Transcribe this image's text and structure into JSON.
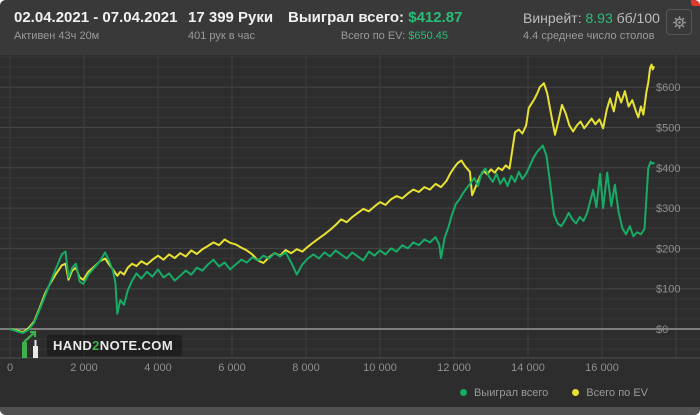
{
  "header": {
    "date_range": "02.04.2021 - 07.04.2021",
    "active_time": "Активен 43ч 20м",
    "hands_total": "17 399 Руки",
    "hands_per_hour": "401 рук в час",
    "won_label": "Выиграл всего: ",
    "won_value": "$412.87",
    "ev_label": "Всего по EV: ",
    "ev_value": "$650.45",
    "winrate_label": "Винрейт: ",
    "winrate_value": "8.93",
    "winrate_unit": " бб/100",
    "avg_tables": "4.4 среднее число столов"
  },
  "logo": {
    "pre": "HAND",
    "mid": "2",
    "post": "NOTE.COM"
  },
  "colors": {
    "header_bg": "#393939",
    "chart_bg": "#2d2d2d",
    "green": "#17ab66",
    "green_bright": "#2bbd77",
    "yellow": "#e8e233",
    "grid_minor": "#383838",
    "grid_major": "#474747",
    "grid_vertical": "#3e3e3e",
    "zero_line": "#7d7d7d",
    "axis_text": "#8f8f8f",
    "red_close": "#e2392b"
  },
  "chart_data": {
    "type": "line",
    "title": "",
    "xlabel": "",
    "ylabel": "",
    "x_unit": "hands",
    "y_unit": "USD",
    "x_max_hands": 17399,
    "xlim": [
      0,
      18650
    ],
    "ylim": [
      -72,
      680
    ],
    "grid": true,
    "legend_position": "bottom-right",
    "x_ticks": [
      0,
      2000,
      4000,
      6000,
      8000,
      10000,
      12000,
      14000,
      16000
    ],
    "x_tick_labels": [
      "0",
      "2 000",
      "4 000",
      "6 000",
      "8 000",
      "10 000",
      "12 000",
      "14 000",
      "16 000"
    ],
    "y_ticks": [
      0,
      100,
      200,
      300,
      400,
      500,
      600
    ],
    "y_tick_labels": [
      "$0",
      "$100",
      "$200",
      "$300",
      "$400",
      "$500",
      "$600"
    ],
    "series": [
      {
        "name": "Выиграл всего",
        "color": "#17ab66",
        "final_value": 412.87,
        "points": [
          [
            0,
            0
          ],
          [
            200,
            -6
          ],
          [
            350,
            -10
          ],
          [
            500,
            -2
          ],
          [
            650,
            15
          ],
          [
            800,
            48
          ],
          [
            950,
            82
          ],
          [
            1100,
            118
          ],
          [
            1250,
            152
          ],
          [
            1400,
            185
          ],
          [
            1500,
            192
          ],
          [
            1580,
            128
          ],
          [
            1680,
            152
          ],
          [
            1780,
            162
          ],
          [
            1880,
            118
          ],
          [
            1980,
            112
          ],
          [
            2120,
            135
          ],
          [
            2280,
            152
          ],
          [
            2430,
            168
          ],
          [
            2570,
            190
          ],
          [
            2680,
            168
          ],
          [
            2780,
            145
          ],
          [
            2850,
            115
          ],
          [
            2900,
            38
          ],
          [
            2980,
            72
          ],
          [
            3080,
            60
          ],
          [
            3180,
            95
          ],
          [
            3300,
            120
          ],
          [
            3420,
            138
          ],
          [
            3550,
            125
          ],
          [
            3700,
            142
          ],
          [
            3850,
            130
          ],
          [
            4000,
            148
          ],
          [
            4150,
            128
          ],
          [
            4300,
            138
          ],
          [
            4450,
            120
          ],
          [
            4600,
            132
          ],
          [
            4750,
            145
          ],
          [
            4900,
            135
          ],
          [
            5050,
            152
          ],
          [
            5200,
            145
          ],
          [
            5350,
            160
          ],
          [
            5500,
            172
          ],
          [
            5650,
            155
          ],
          [
            5800,
            165
          ],
          [
            5950,
            148
          ],
          [
            6100,
            160
          ],
          [
            6250,
            172
          ],
          [
            6400,
            165
          ],
          [
            6550,
            178
          ],
          [
            6700,
            170
          ],
          [
            6850,
            182
          ],
          [
            7000,
            175
          ],
          [
            7150,
            188
          ],
          [
            7300,
            180
          ],
          [
            7450,
            190
          ],
          [
            7600,
            165
          ],
          [
            7750,
            135
          ],
          [
            7900,
            160
          ],
          [
            8050,
            175
          ],
          [
            8200,
            185
          ],
          [
            8350,
            175
          ],
          [
            8500,
            190
          ],
          [
            8650,
            180
          ],
          [
            8800,
            195
          ],
          [
            8950,
            185
          ],
          [
            9100,
            175
          ],
          [
            9250,
            190
          ],
          [
            9400,
            180
          ],
          [
            9550,
            170
          ],
          [
            9700,
            192
          ],
          [
            9850,
            182
          ],
          [
            10000,
            195
          ],
          [
            10150,
            185
          ],
          [
            10300,
            200
          ],
          [
            10450,
            192
          ],
          [
            10600,
            208
          ],
          [
            10750,
            200
          ],
          [
            10900,
            215
          ],
          [
            11050,
            208
          ],
          [
            11200,
            222
          ],
          [
            11350,
            215
          ],
          [
            11500,
            228
          ],
          [
            11600,
            210
          ],
          [
            11650,
            176
          ],
          [
            11750,
            228
          ],
          [
            11850,
            252
          ],
          [
            11950,
            285
          ],
          [
            12050,
            310
          ],
          [
            12150,
            322
          ],
          [
            12250,
            338
          ],
          [
            12350,
            350
          ],
          [
            12450,
            362
          ],
          [
            12550,
            375
          ],
          [
            12650,
            355
          ],
          [
            12750,
            388
          ],
          [
            12850,
            398
          ],
          [
            12950,
            378
          ],
          [
            13050,
            365
          ],
          [
            13150,
            385
          ],
          [
            13250,
            360
          ],
          [
            13350,
            375
          ],
          [
            13450,
            355
          ],
          [
            13550,
            380
          ],
          [
            13650,
            365
          ],
          [
            13750,
            390
          ],
          [
            13850,
            372
          ],
          [
            13950,
            385
          ],
          [
            14050,
            405
          ],
          [
            14150,
            425
          ],
          [
            14250,
            440
          ],
          [
            14400,
            455
          ],
          [
            14500,
            430
          ],
          [
            14600,
            360
          ],
          [
            14700,
            285
          ],
          [
            14800,
            262
          ],
          [
            14900,
            255
          ],
          [
            15000,
            270
          ],
          [
            15100,
            288
          ],
          [
            15200,
            272
          ],
          [
            15300,
            262
          ],
          [
            15400,
            278
          ],
          [
            15500,
            268
          ],
          [
            15600,
            288
          ],
          [
            15760,
            345
          ],
          [
            15850,
            302
          ],
          [
            15950,
            385
          ],
          [
            16030,
            300
          ],
          [
            16140,
            388
          ],
          [
            16250,
            305
          ],
          [
            16350,
            358
          ],
          [
            16450,
            290
          ],
          [
            16550,
            250
          ],
          [
            16650,
            235
          ],
          [
            16750,
            255
          ],
          [
            16850,
            230
          ],
          [
            16950,
            240
          ],
          [
            17050,
            235
          ],
          [
            17150,
            248
          ],
          [
            17250,
            400
          ],
          [
            17320,
            415
          ],
          [
            17360,
            410
          ],
          [
            17399,
            412
          ]
        ]
      },
      {
        "name": "Всего по EV",
        "color": "#e8e233",
        "final_value": 650.45,
        "points": [
          [
            0,
            0
          ],
          [
            200,
            -4
          ],
          [
            350,
            -8
          ],
          [
            500,
            2
          ],
          [
            650,
            18
          ],
          [
            800,
            52
          ],
          [
            950,
            88
          ],
          [
            1100,
            115
          ],
          [
            1250,
            138
          ],
          [
            1400,
            158
          ],
          [
            1500,
            162
          ],
          [
            1580,
            122
          ],
          [
            1680,
            145
          ],
          [
            1780,
            152
          ],
          [
            1880,
            128
          ],
          [
            1980,
            122
          ],
          [
            2120,
            142
          ],
          [
            2280,
            155
          ],
          [
            2430,
            168
          ],
          [
            2570,
            175
          ],
          [
            2680,
            160
          ],
          [
            2780,
            148
          ],
          [
            2900,
            132
          ],
          [
            2980,
            142
          ],
          [
            3080,
            135
          ],
          [
            3180,
            152
          ],
          [
            3300,
            162
          ],
          [
            3420,
            156
          ],
          [
            3550,
            168
          ],
          [
            3700,
            160
          ],
          [
            3850,
            172
          ],
          [
            4000,
            182
          ],
          [
            4150,
            172
          ],
          [
            4300,
            185
          ],
          [
            4450,
            176
          ],
          [
            4600,
            188
          ],
          [
            4750,
            180
          ],
          [
            4900,
            195
          ],
          [
            5050,
            186
          ],
          [
            5200,
            198
          ],
          [
            5350,
            206
          ],
          [
            5500,
            215
          ],
          [
            5650,
            208
          ],
          [
            5800,
            222
          ],
          [
            5950,
            214
          ],
          [
            6100,
            210
          ],
          [
            6250,
            202
          ],
          [
            6400,
            195
          ],
          [
            6550,
            185
          ],
          [
            6700,
            170
          ],
          [
            6850,
            164
          ],
          [
            7000,
            178
          ],
          [
            7150,
            188
          ],
          [
            7300,
            182
          ],
          [
            7450,
            196
          ],
          [
            7600,
            188
          ],
          [
            7750,
            198
          ],
          [
            7900,
            192
          ],
          [
            8050,
            204
          ],
          [
            8200,
            215
          ],
          [
            8350,
            225
          ],
          [
            8500,
            235
          ],
          [
            8650,
            246
          ],
          [
            8800,
            258
          ],
          [
            8950,
            272
          ],
          [
            9100,
            265
          ],
          [
            9250,
            278
          ],
          [
            9400,
            288
          ],
          [
            9550,
            298
          ],
          [
            9700,
            292
          ],
          [
            9850,
            304
          ],
          [
            10000,
            315
          ],
          [
            10150,
            308
          ],
          [
            10300,
            322
          ],
          [
            10450,
            330
          ],
          [
            10600,
            324
          ],
          [
            10750,
            336
          ],
          [
            10900,
            346
          ],
          [
            11050,
            340
          ],
          [
            11200,
            352
          ],
          [
            11350,
            346
          ],
          [
            11500,
            360
          ],
          [
            11650,
            352
          ],
          [
            11800,
            368
          ],
          [
            11900,
            386
          ],
          [
            12000,
            400
          ],
          [
            12100,
            412
          ],
          [
            12200,
            418
          ],
          [
            12300,
            404
          ],
          [
            12430,
            390
          ],
          [
            12490,
            332
          ],
          [
            12600,
            356
          ],
          [
            12700,
            378
          ],
          [
            12800,
            392
          ],
          [
            12900,
            384
          ],
          [
            13000,
            396
          ],
          [
            13100,
            388
          ],
          [
            13200,
            400
          ],
          [
            13300,
            394
          ],
          [
            13400,
            406
          ],
          [
            13500,
            398
          ],
          [
            13650,
            488
          ],
          [
            13750,
            495
          ],
          [
            13850,
            485
          ],
          [
            13950,
            505
          ],
          [
            14020,
            548
          ],
          [
            14100,
            560
          ],
          [
            14180,
            572
          ],
          [
            14250,
            585
          ],
          [
            14320,
            600
          ],
          [
            14430,
            610
          ],
          [
            14520,
            585
          ],
          [
            14600,
            545
          ],
          [
            14730,
            482
          ],
          [
            14820,
            515
          ],
          [
            14920,
            556
          ],
          [
            15020,
            535
          ],
          [
            15120,
            505
          ],
          [
            15220,
            490
          ],
          [
            15320,
            505
          ],
          [
            15420,
            515
          ],
          [
            15520,
            498
          ],
          [
            15620,
            510
          ],
          [
            15720,
            522
          ],
          [
            15820,
            508
          ],
          [
            15930,
            520
          ],
          [
            16030,
            498
          ],
          [
            16130,
            545
          ],
          [
            16220,
            572
          ],
          [
            16320,
            540
          ],
          [
            16420,
            588
          ],
          [
            16520,
            562
          ],
          [
            16620,
            590
          ],
          [
            16720,
            552
          ],
          [
            16820,
            568
          ],
          [
            16920,
            540
          ],
          [
            16980,
            525
          ],
          [
            17050,
            552
          ],
          [
            17120,
            532
          ],
          [
            17200,
            588
          ],
          [
            17250,
            612
          ],
          [
            17300,
            648
          ],
          [
            17340,
            656
          ],
          [
            17370,
            644
          ],
          [
            17399,
            650
          ]
        ]
      }
    ]
  }
}
